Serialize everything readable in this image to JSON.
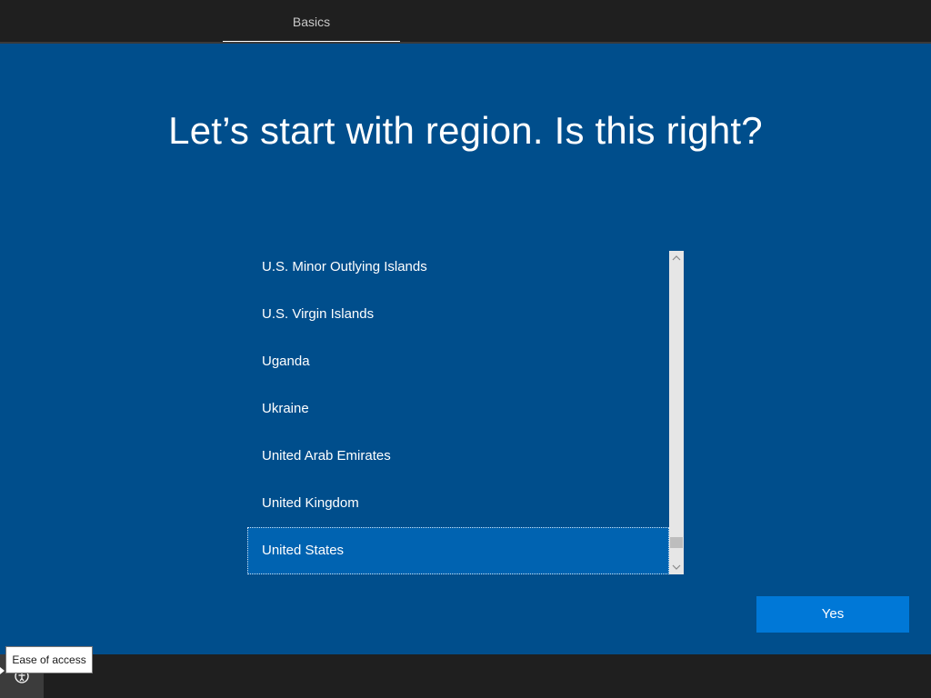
{
  "header": {
    "tab_label": "Basics"
  },
  "page": {
    "heading": "Let’s start with region. Is this right?"
  },
  "region_list": {
    "items": [
      "U.S. Minor Outlying Islands",
      "U.S. Virgin Islands",
      "Uganda",
      "Ukraine",
      "United Arab Emirates",
      "United Kingdom",
      "United States"
    ],
    "selected": "United States"
  },
  "scrollbar": {
    "up_icon": "chevron-up-icon",
    "down_icon": "chevron-down-icon"
  },
  "actions": {
    "yes_label": "Yes"
  },
  "footer": {
    "ease_of_access_tooltip": "Ease of access",
    "ease_of_access_icon": "ease-of-access-icon"
  },
  "colors": {
    "background": "#004e8c",
    "selected_item": "#0063b1",
    "button": "#0078d7",
    "bars": "#1f1f1f"
  }
}
